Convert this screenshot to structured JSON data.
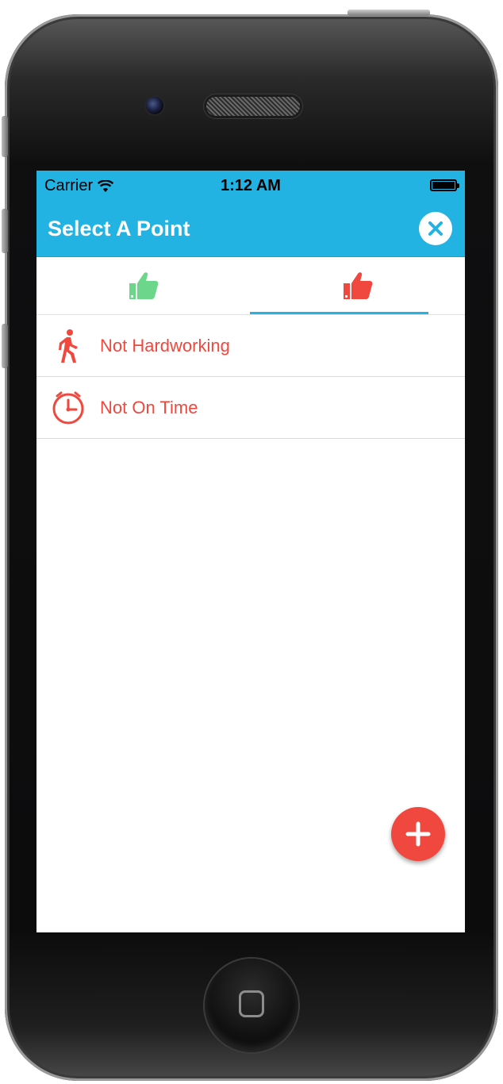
{
  "status_bar": {
    "carrier": "Carrier",
    "time": "1:12 AM",
    "wifi_icon": "wifi-icon",
    "battery_icon": "battery-icon"
  },
  "header": {
    "title": "Select A Point",
    "close_icon": "close-icon"
  },
  "tabs": [
    {
      "icon": "thumbs-up-icon",
      "color": "#6cd68a",
      "selected": false
    },
    {
      "icon": "thumbs-down-icon",
      "color": "#f0483e",
      "selected": true
    }
  ],
  "points": [
    {
      "label": "Not Hardworking",
      "icon": "walking-person-icon"
    },
    {
      "label": "Not On Time",
      "icon": "clock-icon"
    }
  ],
  "fab": {
    "icon": "plus-icon"
  },
  "colors": {
    "primary": "#23b3e3",
    "negative": "#f0483e",
    "positive": "#6cd68a"
  }
}
